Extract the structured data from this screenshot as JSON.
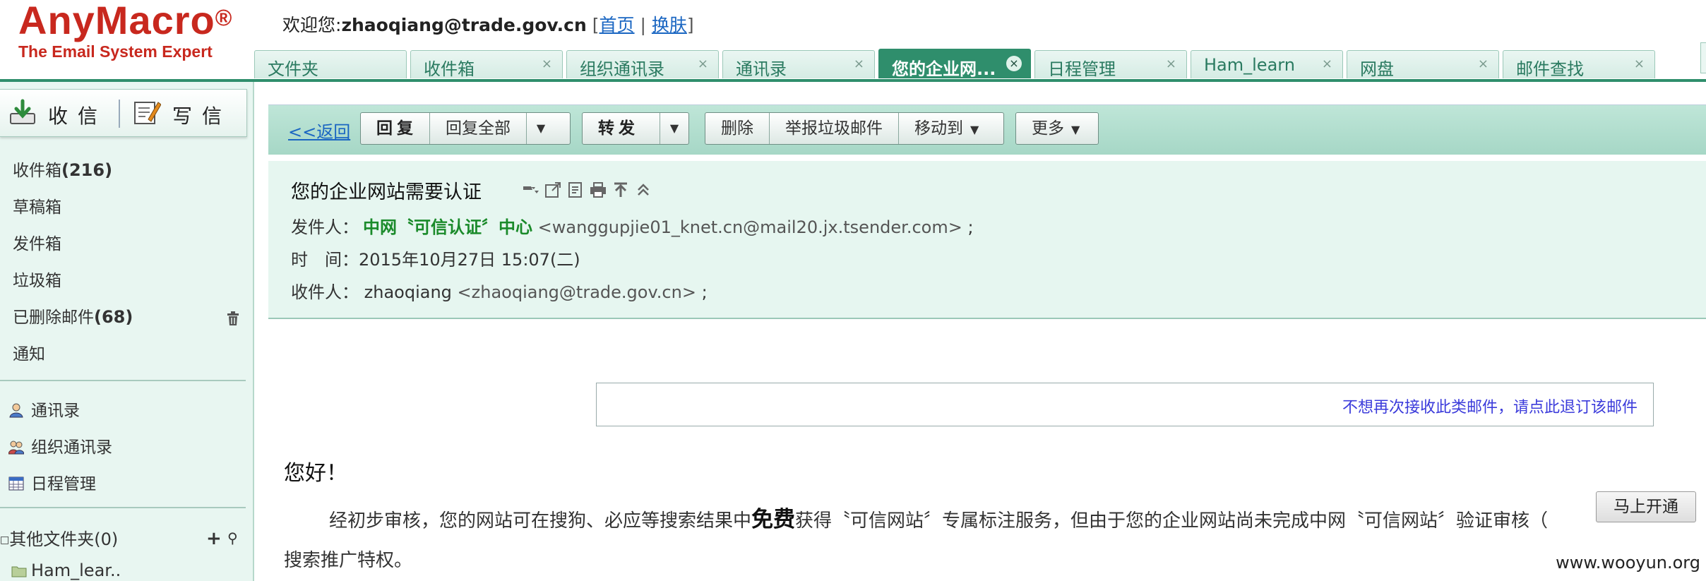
{
  "logo": {
    "name": "AnyMacro",
    "reg": "®",
    "tagline": "The Email System Expert"
  },
  "welcome": {
    "prefix": "欢迎您:",
    "user": "zhaoqiang@trade.gov.cn",
    "bracket_open": "[",
    "home": "首页",
    "sep": "|",
    "skin": "换肤",
    "bracket_close": "]"
  },
  "tabs": [
    {
      "label": "文件夹",
      "closable": false
    },
    {
      "label": "收件箱",
      "closable": true
    },
    {
      "label": "组织通讯录",
      "closable": true
    },
    {
      "label": "通讯录",
      "closable": true
    },
    {
      "label": "您的企业网...",
      "closable": true,
      "active": true
    },
    {
      "label": "日程管理",
      "closable": true
    },
    {
      "label": "Ham_learn",
      "closable": true
    },
    {
      "label": "网盘",
      "closable": true
    },
    {
      "label": "邮件查找",
      "closable": true
    }
  ],
  "tab_close": "×",
  "compose": {
    "receive": "收信",
    "write": "写信"
  },
  "folders": [
    {
      "label": "收件箱",
      "count": "(216)"
    },
    {
      "label": "草稿箱",
      "count": ""
    },
    {
      "label": "发件箱",
      "count": ""
    },
    {
      "label": "垃圾箱",
      "count": ""
    },
    {
      "label": "已删除邮件",
      "count": "(68)"
    },
    {
      "label": "通知",
      "count": ""
    }
  ],
  "tools": [
    {
      "label": "通讯录",
      "icon": "contacts-icon"
    },
    {
      "label": "组织通讯录",
      "icon": "org-contacts-icon"
    },
    {
      "label": "日程管理",
      "icon": "calendar-icon"
    }
  ],
  "other_folders": {
    "toggle": "□",
    "label": "其他文件夹(0)",
    "add": "+",
    "pin": "⚲"
  },
  "ham_folder": "Ham_lear..",
  "toolbar": {
    "back": "<<返回",
    "reply": "回复",
    "reply_all": "回复全部",
    "forward": "转发",
    "delete": "删除",
    "report_spam": "举报垃圾邮件",
    "move_to": "移动到",
    "more": "更多",
    "caret": "▼"
  },
  "message": {
    "subject": "您的企业网站需要认证",
    "from_label": "发件人：",
    "from_name": "中网〝可信认证〞中心",
    "from_addr": "<wanggupjie01_knet.cn@mail20.jx.tsender.com>",
    "from_end": ";",
    "time_label": "时　间：",
    "time_value": "2015年10月27日 15:07(二)",
    "to_label": "收件人：",
    "to_name": "zhaoqiang",
    "to_addr": "<zhaoqiang@trade.gov.cn>",
    "to_end": ";"
  },
  "body": {
    "unsubscribe": "不想再次接收此类邮件，请点此退订该邮件",
    "greeting": "您好！",
    "para1_a": "经初步审核，您的网站可在搜狗、必应等搜索结果中",
    "para1_em": "免费",
    "para1_b": "获得〝可信网站〞专属标注服务，但由于您的企业网站尚未完成中网〝可信网站〞验证审核（",
    "para2": "搜索推广特权。",
    "open_button": "马上开通"
  },
  "watermark": "www.wooyun.org",
  "colors": {
    "brand_red": "#c8281e",
    "accent_green": "#2f8e6c",
    "sidebar_bg": "#e8f6f1",
    "link_blue": "#1a66c2",
    "sender_green": "#1a8a2a"
  }
}
